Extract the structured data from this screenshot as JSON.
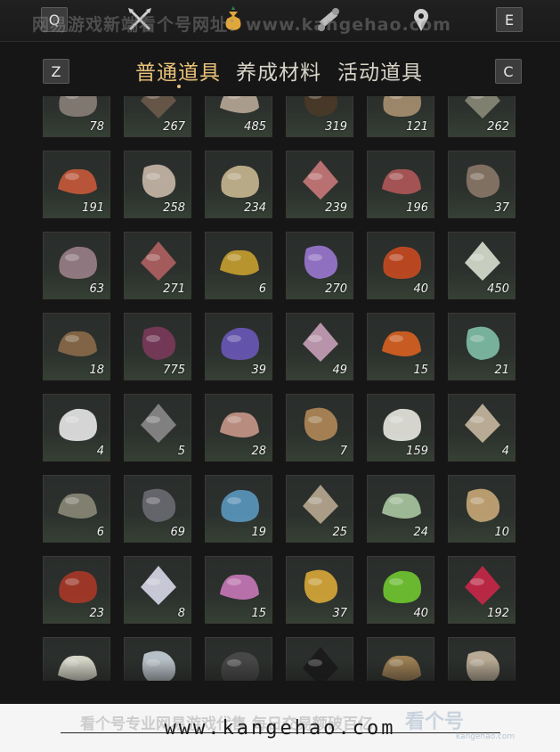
{
  "hotkeys": {
    "prev_category": "Q",
    "next_category": "E",
    "prev_tab": "Z",
    "next_tab": "C"
  },
  "watermark": {
    "top": "网易游戏新端看个号网址：www.kangehao.com",
    "bottom": "看个号专业网易游戏代售 每日交易额破百亿",
    "site": "www.kangehao.com",
    "logo": "看个号",
    "logo_sub": "kangehao.com"
  },
  "top_icons": [
    "crossed-swords-icon",
    "pouch-icon",
    "scroll-icon",
    "location-pin-icon"
  ],
  "tabs": [
    {
      "label": "普通道具",
      "active": true
    },
    {
      "label": "养成材料",
      "active": false
    },
    {
      "label": "活动道具",
      "active": false
    }
  ],
  "items": [
    {
      "icon": "stone-icon",
      "qty": "78",
      "color": "#8a7f78"
    },
    {
      "icon": "feather-icon",
      "qty": "267",
      "color": "#6b5a4a"
    },
    {
      "icon": "mushroom-pile-icon",
      "qty": "485",
      "color": "#b8a898"
    },
    {
      "icon": "scorpion-icon",
      "qty": "319",
      "color": "#4a3a28"
    },
    {
      "icon": "grain-sack-icon",
      "qty": "121",
      "color": "#a89070"
    },
    {
      "icon": "fish-icon",
      "qty": "262",
      "color": "#8a8a78"
    },
    {
      "icon": "berries-icon",
      "qty": "191",
      "color": "#c85a3a"
    },
    {
      "icon": "mushrooms-icon",
      "qty": "258",
      "color": "#c8b8a8"
    },
    {
      "icon": "eggs-icon",
      "qty": "234",
      "color": "#c8b890"
    },
    {
      "icon": "meat-chunks-icon",
      "qty": "239",
      "color": "#c87878"
    },
    {
      "icon": "steak-icon",
      "qty": "196",
      "color": "#b05858"
    },
    {
      "icon": "hide-icon",
      "qty": "37",
      "color": "#8a7868"
    },
    {
      "icon": "intestine-icon",
      "qty": "63",
      "color": "#9a8088"
    },
    {
      "icon": "raw-meat-icon",
      "qty": "271",
      "color": "#b06060"
    },
    {
      "icon": "golden-carp-icon",
      "qty": "6",
      "color": "#c8a030"
    },
    {
      "icon": "purple-crystal-icon",
      "qty": "270",
      "color": "#9a78d0"
    },
    {
      "icon": "amber-stone-icon",
      "qty": "40",
      "color": "#c84a20"
    },
    {
      "icon": "white-herb-icon",
      "qty": "450",
      "color": "#d8e0d0"
    },
    {
      "icon": "mortar-icon",
      "qty": "18",
      "color": "#8a6a48"
    },
    {
      "icon": "purple-flower-icon",
      "qty": "775",
      "color": "#7a3a5a"
    },
    {
      "icon": "lavender-icon",
      "qty": "39",
      "color": "#6a58b8"
    },
    {
      "icon": "pink-blossom-icon",
      "qty": "49",
      "color": "#c8a0b8"
    },
    {
      "icon": "orange-flower-icon",
      "qty": "15",
      "color": "#d86020"
    },
    {
      "icon": "jade-icon",
      "qty": "21",
      "color": "#80c0a8"
    },
    {
      "icon": "white-feather-icon",
      "qty": "4",
      "color": "#e8e8e8"
    },
    {
      "icon": "grey-feather-icon",
      "qty": "5",
      "color": "#8a8a8a"
    },
    {
      "icon": "fish-fillet-icon",
      "qty": "28",
      "color": "#c89888"
    },
    {
      "icon": "fur-pelt-icon",
      "qty": "7",
      "color": "#b08858"
    },
    {
      "icon": "white-fleece-icon",
      "qty": "159",
      "color": "#e8e8e0"
    },
    {
      "icon": "pufferfish-icon",
      "qty": "4",
      "color": "#c8b8a0"
    },
    {
      "icon": "catfish-icon",
      "qty": "6",
      "color": "#8a8878"
    },
    {
      "icon": "iron-ore-icon",
      "qty": "69",
      "color": "#6a6a72"
    },
    {
      "icon": "blue-ore-icon",
      "qty": "19",
      "color": "#5a98c0"
    },
    {
      "icon": "bone-icon",
      "qty": "25",
      "color": "#b8a890"
    },
    {
      "icon": "melon-icon",
      "qty": "24",
      "color": "#a8c8a0"
    },
    {
      "icon": "bundle-icon",
      "qty": "10",
      "color": "#c8a878"
    },
    {
      "icon": "red-twig-icon",
      "qty": "23",
      "color": "#a83828"
    },
    {
      "icon": "white-chrysanthemum-icon",
      "qty": "8",
      "color": "#d8d8e8"
    },
    {
      "icon": "pink-chrysanthemum-icon",
      "qty": "15",
      "color": "#c878b8"
    },
    {
      "icon": "firework-icon",
      "qty": "37",
      "color": "#d8a838"
    },
    {
      "icon": "green-orb-icon",
      "qty": "40",
      "color": "#70c830"
    },
    {
      "icon": "ruby-icon",
      "qty": "192",
      "color": "#c82848"
    },
    {
      "icon": "white-coral-icon",
      "qty": "",
      "color": "#e8e8d8"
    },
    {
      "icon": "lantern-icon",
      "qty": "",
      "color": "#c8d0d8"
    },
    {
      "icon": "dark-feather-icon",
      "qty": "",
      "color": "#4a4a4a"
    },
    {
      "icon": "black-fur-icon",
      "qty": "",
      "color": "#1a1a1a"
    },
    {
      "icon": "shell-icon",
      "qty": "",
      "color": "#a88858"
    },
    {
      "icon": "bowl-icon",
      "qty": "",
      "color": "#c8b8a0"
    }
  ]
}
